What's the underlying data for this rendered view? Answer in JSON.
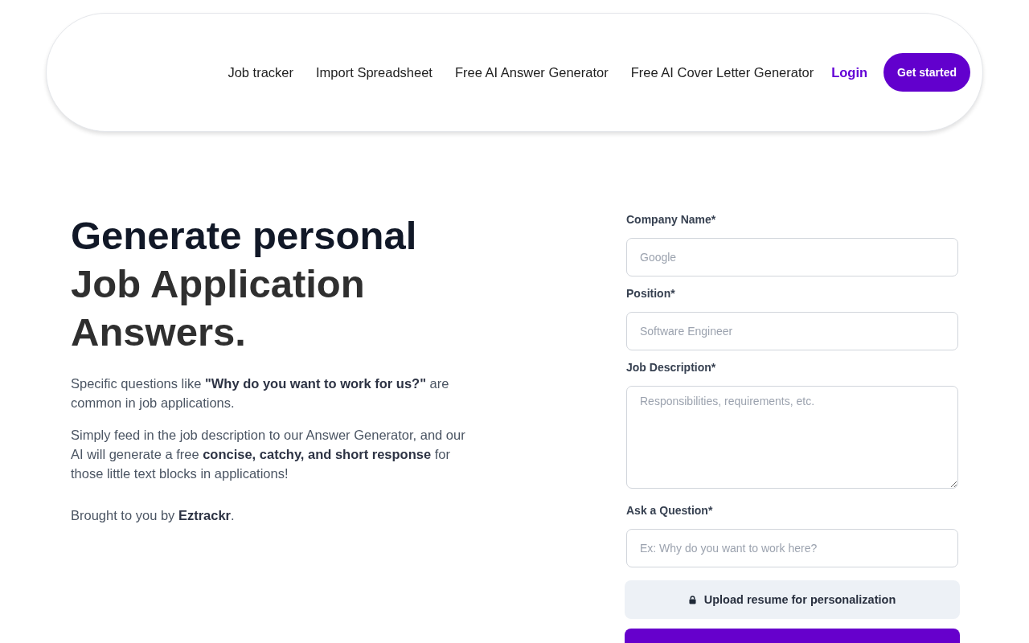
{
  "nav": {
    "links": [
      "Job tracker",
      "Import Spreadsheet",
      "Free AI Answer Generator",
      "Free AI Cover Letter Generator"
    ],
    "login": "Login",
    "cta": "Get started"
  },
  "hero": {
    "heading_lead": "Generate personal",
    "heading_rest": "Job Application Answers.",
    "paragraphs": [
      "Specific questions like **\"Why do you want to work for us?\"** are common in job applications.",
      "Simply feed in the job description to our Answer Generator, and our AI will generate a free **concise, catchy, and short response** for those little text blocks in applications!",
      "Brought to you by **Eztrackr**."
    ]
  },
  "form": {
    "fields": [
      {
        "label": "Company Name*",
        "kind": "input",
        "placeholder": "Google"
      },
      {
        "label": "Position*",
        "kind": "input",
        "placeholder": "Software Engineer"
      },
      {
        "label": "Job Description*",
        "kind": "textarea",
        "placeholder": "Responsibilities, requirements, etc."
      },
      {
        "label": "Ask a Question*",
        "kind": "input",
        "placeholder": "Ex: Why do you want to work here?"
      }
    ],
    "buttons": [
      {
        "kind": "secondary",
        "label": "Upload resume for personalization"
      },
      {
        "kind": "primary"
      }
    ]
  }
}
